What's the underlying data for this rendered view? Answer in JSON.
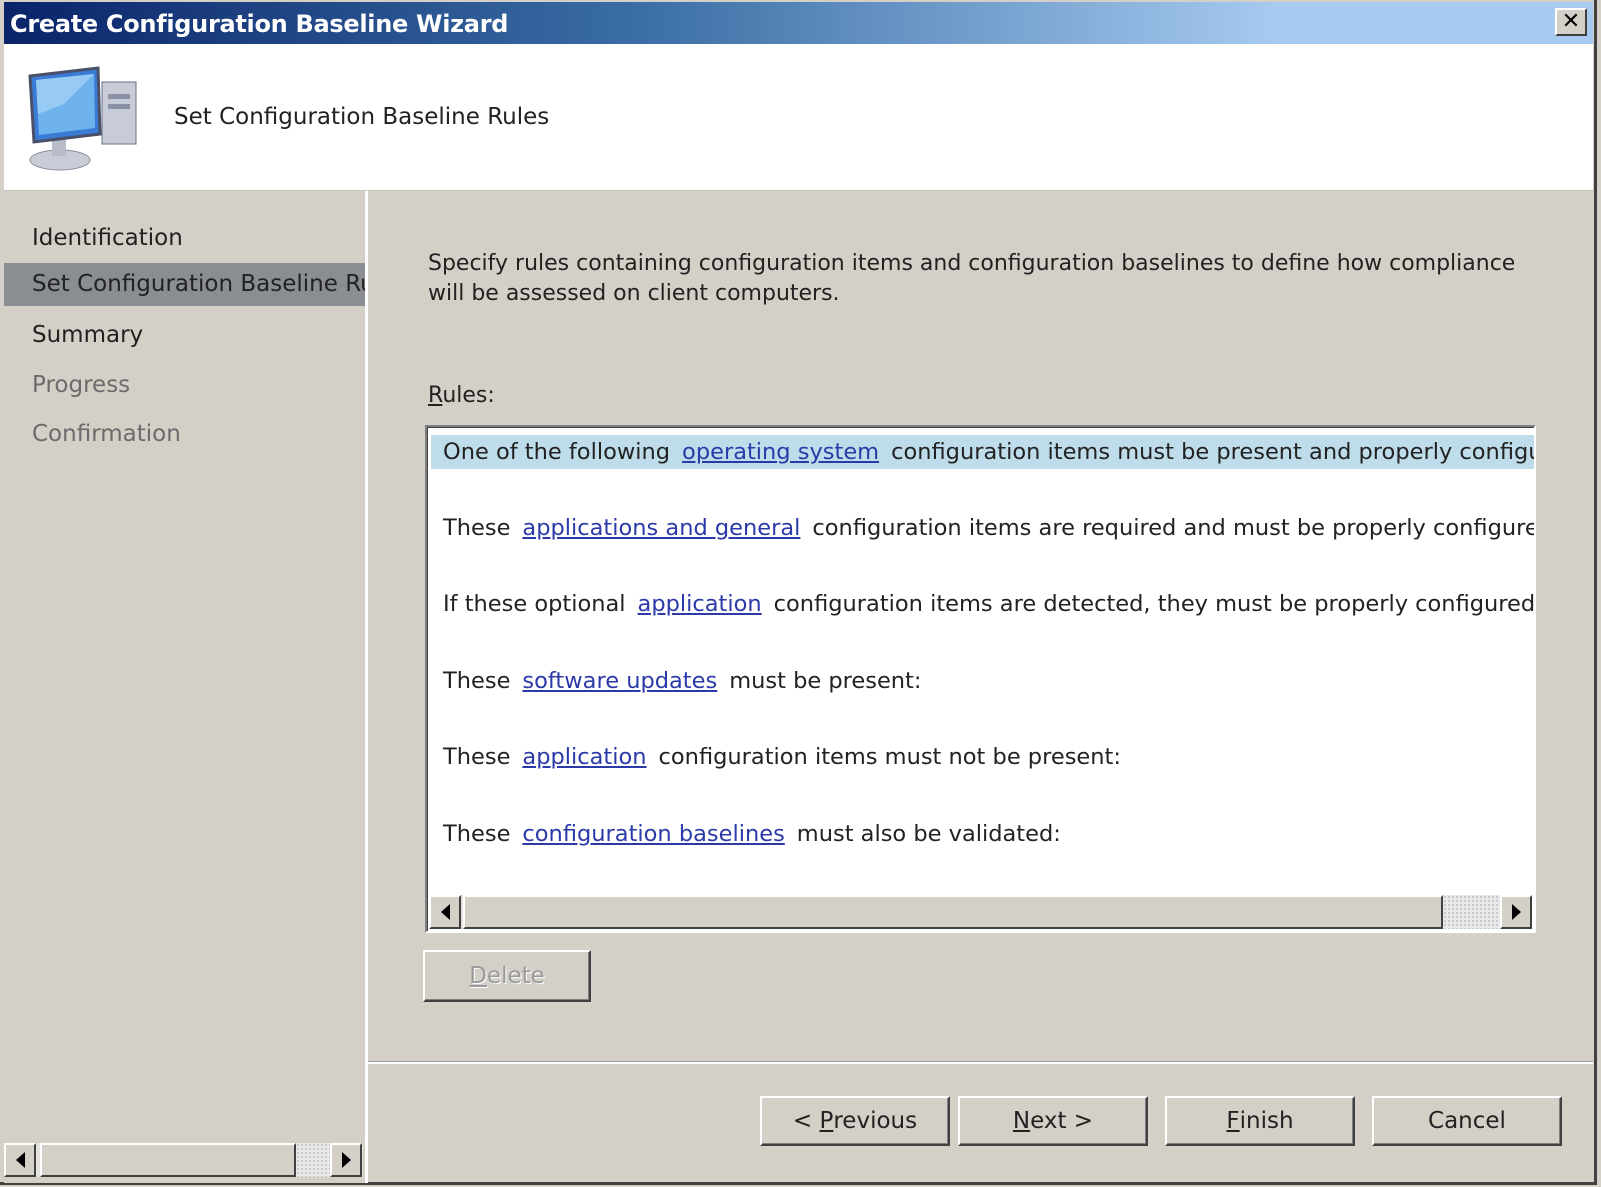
{
  "window": {
    "title": "Create Configuration Baseline Wizard",
    "close_label": "✕"
  },
  "header": {
    "title": "Set Configuration Baseline Rules",
    "icon": "computer-icon"
  },
  "sidebar": {
    "items": [
      {
        "label": "Identification",
        "state": "normal"
      },
      {
        "label": "Set Configuration Baseline Rules",
        "state": "selected"
      },
      {
        "label": "Summary",
        "state": "normal"
      },
      {
        "label": "Progress",
        "state": "disabled"
      },
      {
        "label": "Confirmation",
        "state": "disabled"
      }
    ]
  },
  "main": {
    "description": "Specify rules containing configuration items and configuration baselines to define how compliance will be assessed on client computers.",
    "rules_label_mnemonic": "R",
    "rules_label_rest": "ules:",
    "rules": [
      {
        "prefix": "One of the following",
        "link": "operating system",
        "suffix": "configuration items must be present and properly configured",
        "selected": true
      },
      {
        "prefix": "These",
        "link": "applications and general",
        "suffix": "configuration items are required and must be properly configured:",
        "selected": false
      },
      {
        "prefix": "If these optional",
        "link": "application",
        "suffix": "configuration items are detected, they must be properly configured:",
        "selected": false
      },
      {
        "prefix": "These",
        "link": "software updates",
        "suffix": "must be present:",
        "selected": false
      },
      {
        "prefix": "These",
        "link": "application",
        "suffix": "configuration items must not be present:",
        "selected": false
      },
      {
        "prefix": "These",
        "link": "configuration baselines",
        "suffix": "must also be validated:",
        "selected": false
      }
    ],
    "delete_mnemonic": "D",
    "delete_rest": "elete"
  },
  "footer": {
    "previous": {
      "pre": "< ",
      "mn": "P",
      "post": "revious"
    },
    "next": {
      "pre": "",
      "mn": "N",
      "post": "ext >"
    },
    "finish": {
      "pre": "",
      "mn": "F",
      "post": "inish"
    },
    "cancel": "Cancel"
  }
}
